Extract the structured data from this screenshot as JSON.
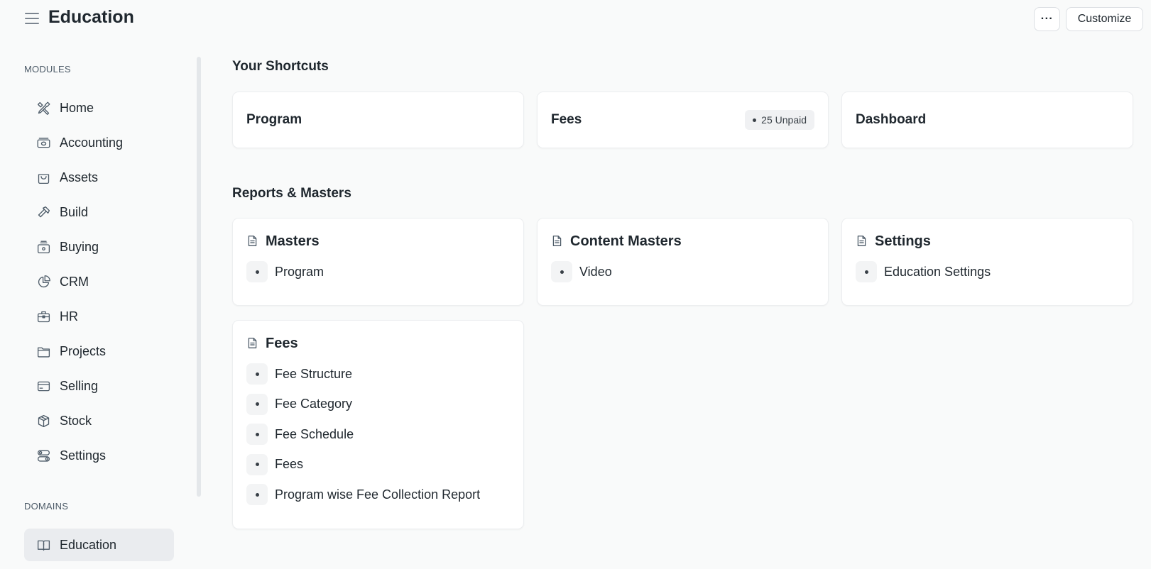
{
  "header": {
    "title": "Education",
    "more_label": "···",
    "customize_label": "Customize"
  },
  "sidebar": {
    "modules_heading": "MODULES",
    "items": [
      {
        "label": "Home",
        "icon": "tools-icon"
      },
      {
        "label": "Accounting",
        "icon": "money-icon"
      },
      {
        "label": "Assets",
        "icon": "bag-icon"
      },
      {
        "label": "Build",
        "icon": "hammer-icon"
      },
      {
        "label": "Buying",
        "icon": "basket-icon"
      },
      {
        "label": "CRM",
        "icon": "pie-icon"
      },
      {
        "label": "HR",
        "icon": "briefcase-icon"
      },
      {
        "label": "Projects",
        "icon": "folder-icon"
      },
      {
        "label": "Selling",
        "icon": "card-icon"
      },
      {
        "label": "Stock",
        "icon": "box-icon"
      },
      {
        "label": "Settings",
        "icon": "toggles-icon"
      }
    ],
    "domains_heading": "DOMAINS",
    "domains": [
      {
        "label": "Education",
        "icon": "book-icon",
        "active": true
      }
    ]
  },
  "shortcuts": {
    "title": "Your Shortcuts",
    "items": [
      {
        "label": "Program"
      },
      {
        "label": "Fees",
        "badge": "25 Unpaid"
      },
      {
        "label": "Dashboard"
      }
    ]
  },
  "reports": {
    "title": "Reports & Masters",
    "cards": [
      {
        "title": "Masters",
        "links": [
          "Program"
        ]
      },
      {
        "title": "Content Masters",
        "links": [
          "Video"
        ]
      },
      {
        "title": "Settings",
        "links": [
          "Education Settings"
        ]
      },
      {
        "title": "Fees",
        "links": [
          "Fee Structure",
          "Fee Category",
          "Fee Schedule",
          "Fees",
          "Program wise Fee Collection Report"
        ]
      }
    ]
  }
}
